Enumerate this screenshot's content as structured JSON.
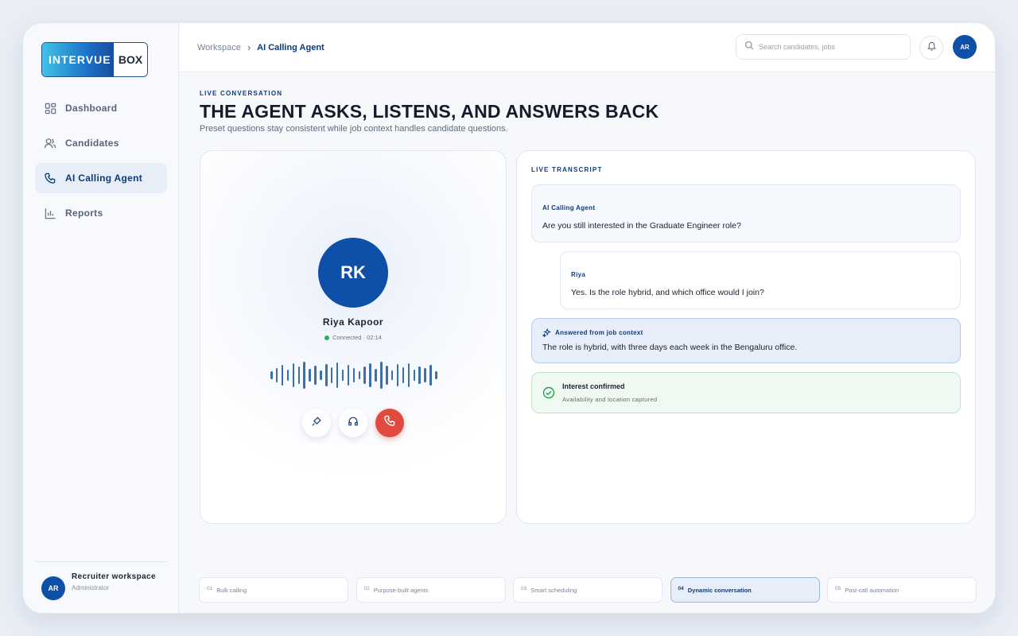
{
  "brand": {
    "logo_left": "INTERVUE",
    "logo_right": "BOX"
  },
  "sidebar": {
    "items": [
      {
        "label": "Dashboard",
        "icon": "grid-icon",
        "active": false
      },
      {
        "label": "Candidates",
        "icon": "users-icon",
        "active": false
      },
      {
        "label": "AI Calling Agent",
        "icon": "phone-icon",
        "active": true
      },
      {
        "label": "Reports",
        "icon": "bar-chart-icon",
        "active": false
      }
    ],
    "footer": {
      "avatar": "AR",
      "name": "Recruiter workspace",
      "role": "Administrator"
    }
  },
  "topbar": {
    "breadcrumb": [
      "Workspace",
      "AI Calling Agent"
    ],
    "search_placeholder": "Search candidates, jobs",
    "avatar": "AR"
  },
  "page": {
    "eyebrow": "LIVE CONVERSATION",
    "title": "THE AGENT ASKS, LISTENS, AND ANSWERS BACK",
    "subtitle": "Preset questions stay consistent while job context handles candidate questions."
  },
  "call": {
    "initials": "RK",
    "name": "Riya Kapoor",
    "status": "Connected · 02:14"
  },
  "transcript": {
    "title": "LIVE TRANSCRIPT",
    "messages": [
      {
        "speaker": "AI Calling Agent",
        "text": "Are you still interested in the Graduate Engineer role?"
      },
      {
        "speaker": "Riya",
        "text": "Yes. Is the role hybrid, and which office would I join?"
      }
    ],
    "context_answer": {
      "label": "Answered from job context",
      "text": "The role is hybrid, with three days each week in the Bengaluru office."
    },
    "confirmation": {
      "title": "Interest confirmed",
      "subtitle": "Availability and location captured"
    }
  },
  "steps": [
    {
      "num": "01",
      "label": "Bulk calling",
      "active": false
    },
    {
      "num": "02",
      "label": "Purpose-built agents",
      "active": false
    },
    {
      "num": "03",
      "label": "Smart scheduling",
      "active": false
    },
    {
      "num": "04",
      "label": "Dynamic conversation",
      "active": true
    },
    {
      "num": "05",
      "label": "Post-call automation",
      "active": false
    }
  ],
  "colors": {
    "accent": "#0e4fa8",
    "end_call": "#e04a3f",
    "success": "#22b55a"
  }
}
